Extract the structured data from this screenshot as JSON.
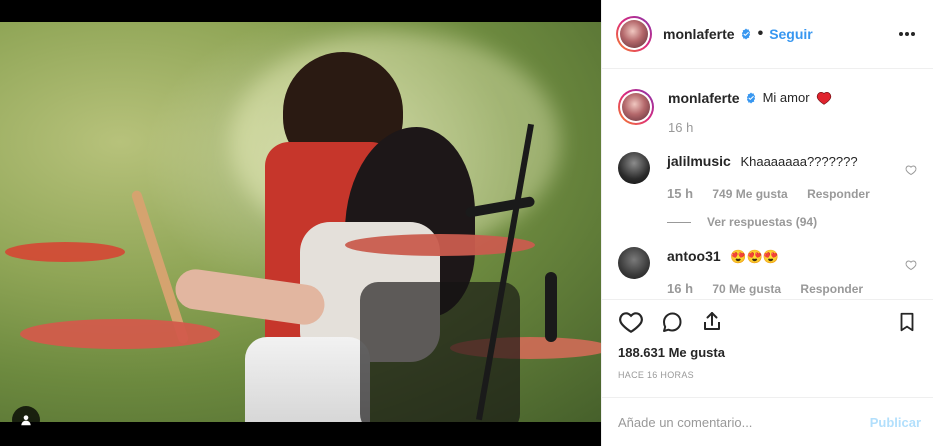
{
  "post": {
    "author": "monlaferte",
    "follow_label": "Seguir",
    "dot": "•",
    "caption": "Mi amor",
    "caption_time": "16 h",
    "likes": "188.631 Me gusta",
    "time_ago": "HACE 16 HORAS",
    "comment_placeholder": "Añade un comentario...",
    "publish_label": "Publicar"
  },
  "comments": [
    {
      "user": "jalilmusic",
      "text": "Khaaaaaaa???????",
      "time": "15 h",
      "likes": "749 Me gusta",
      "reply": "Responder",
      "view_replies": "Ver respuestas (94)"
    },
    {
      "user": "antoo31",
      "text": "😍😍😍",
      "time": "16 h",
      "likes": "70 Me gusta",
      "reply": "Responder"
    }
  ],
  "icons": {
    "menu": "more-options-icon",
    "verified": "verified-badge-icon",
    "like": "heart-icon",
    "comment": "comment-icon",
    "share": "share-icon",
    "save": "bookmark-icon",
    "user_tag": "user-tag-icon"
  },
  "colors": {
    "accent": "#3897f0",
    "heart_red": "#ed4956",
    "muted": "#999999"
  }
}
